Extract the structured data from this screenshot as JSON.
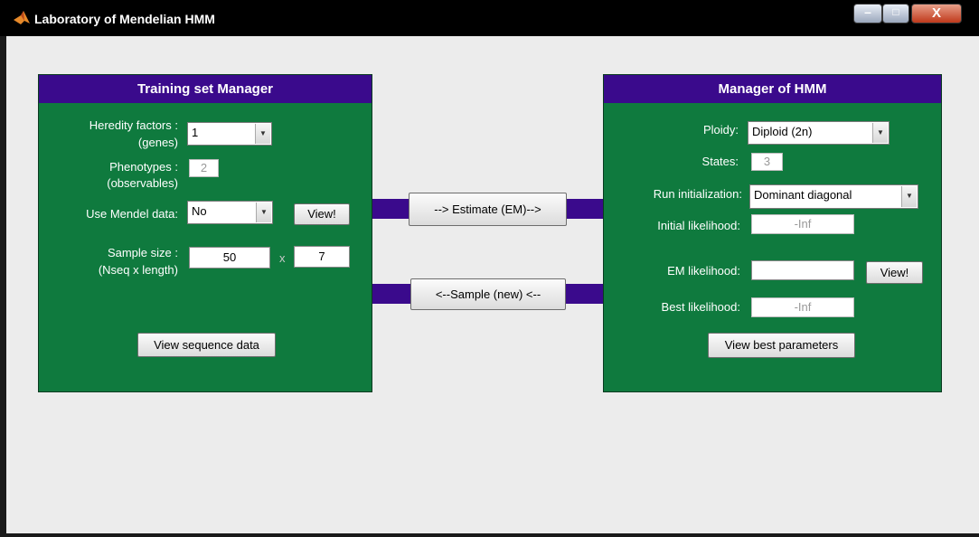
{
  "window": {
    "title": "Laboratory of Mendelian HMM",
    "icon": "matlab-icon",
    "controls": {
      "minimize": "minimize-icon",
      "maximize": "maximize-icon",
      "close_label": "X"
    }
  },
  "training": {
    "header": "Training set Manager",
    "heredity_label": "Heredity factors :",
    "heredity_sub": "(genes)",
    "heredity_value": "1",
    "phenotypes_label": "Phenotypes :",
    "phenotypes_sub": "(observables)",
    "phenotypes_value": "2",
    "mendel_label": "Use Mendel data:",
    "mendel_value": "No",
    "view_button": "View!",
    "sample_label": "Sample size :",
    "sample_sub": "(Nseq x length)",
    "nseq": "50",
    "times": "x",
    "length": "7",
    "view_sequence_button": "View sequence data"
  },
  "middle": {
    "estimate_button": "--> Estimate (EM)-->",
    "sample_button": "<--Sample (new) <--"
  },
  "hmm": {
    "header": "Manager of HMM",
    "ploidy_label": "Ploidy:",
    "ploidy_value": "Diploid (2n)",
    "states_label": "States:",
    "states_value": "3",
    "runinit_label": "Run initialization:",
    "runinit_value": "Dominant diagonal",
    "initlik_label": "Initial likelihood:",
    "initlik_value": "-Inf",
    "emlik_label": "EM likelihood:",
    "emlik_value": "",
    "view_button": "View!",
    "bestlik_label": "Best likelihood:",
    "bestlik_value": "-Inf",
    "view_best_button": "View best parameters"
  },
  "colors": {
    "panel_bg": "#0f7a3e",
    "header_bg": "#3a0a8c",
    "window_bg": "#ececec",
    "titlebar_bg": "#000000"
  }
}
